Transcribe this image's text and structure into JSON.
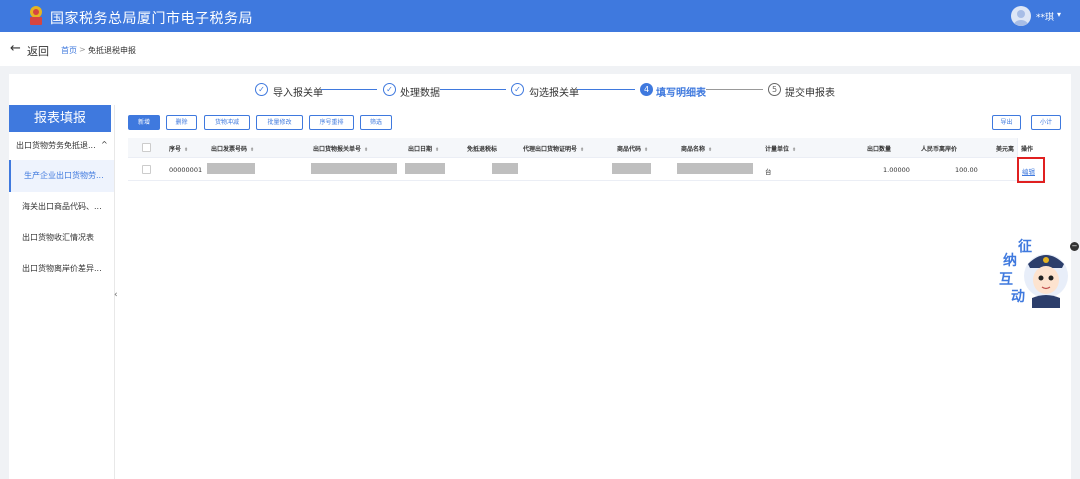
{
  "header": {
    "site_title": "国家税务总局厦门市电子税务局",
    "user_name": "**琪",
    "user_caret": "▾"
  },
  "nav": {
    "back_label": "返回",
    "breadcrumb": [
      "首页",
      "免抵退税申报"
    ],
    "breadcrumb_sep": ">"
  },
  "steps": [
    {
      "label": "导入报关单",
      "status": "done",
      "marker": "✓"
    },
    {
      "label": "处理数据",
      "status": "done",
      "marker": "✓"
    },
    {
      "label": "勾选报关单",
      "status": "done",
      "marker": "✓"
    },
    {
      "label": "填写明细表",
      "status": "active",
      "marker": "4"
    },
    {
      "label": "提交申报表",
      "status": "todo",
      "marker": "5"
    }
  ],
  "sidebar": {
    "title": "报表填报",
    "group_label": "出口货物劳务免抵退...",
    "group_caret": "^",
    "items": [
      {
        "label": "生产企业出口货物劳...",
        "active": true
      },
      {
        "label": "海关出口商品代码、..."
      },
      {
        "label": "出口货物收汇情况表"
      },
      {
        "label": "出口货物离岸价差异..."
      }
    ],
    "collapse_glyph": "‹"
  },
  "toolbar": {
    "add": "新增",
    "delete": "删除",
    "goods_offset": "货物冲减",
    "batch_edit": "批量修改",
    "renumber": "序号重排",
    "filter": "筛选",
    "export": "导出",
    "subtotal": "小计"
  },
  "table": {
    "sort_glyph": "⬍",
    "headers": {
      "seq": "序号",
      "invoice_no": "出口发票号码",
      "declaration_no": "出口货物报关单号",
      "export_date": "出口日期",
      "tax_method": "免抵退税标",
      "agent_cert": "代理出口货物证明号",
      "goods_code": "商品代码",
      "goods_name": "商品名称",
      "unit": "计量单位",
      "quantity": "出口数量",
      "rmb_fob": "人民币离岸价",
      "usd_fob": "美元离",
      "operation": "操作"
    },
    "rows": [
      {
        "seq": "00000001",
        "unit": "台",
        "quantity": "1.00000",
        "rmb_fob": "100.00",
        "operation": "编辑"
      }
    ]
  },
  "widget": {
    "chars": [
      "征",
      "纳",
      "互",
      "动"
    ],
    "close_glyph": "−"
  },
  "colors": {
    "brand": "#3f79de",
    "highlight": "#e02020"
  }
}
